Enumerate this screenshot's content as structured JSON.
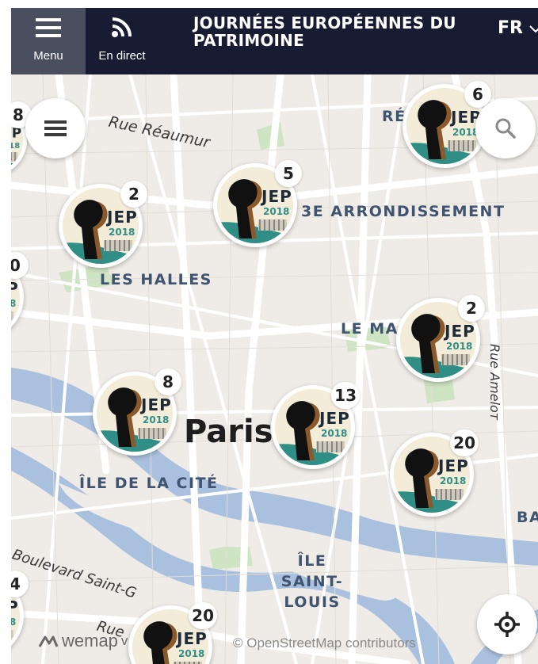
{
  "header": {
    "menu_label": "Menu",
    "live_label": "En direct",
    "title": "JOURNÉES EUROPÉENNES DU PATRIMOINE",
    "language": "FR"
  },
  "map": {
    "streets": [
      "Rue Réaumur",
      "Boulevard Saint-G",
      "Rue Ameloт",
      "Rue"
    ],
    "districts": [
      "RÉ",
      "3E ARRONDISSEMENT",
      "LES HALLES",
      "LE MA",
      "ÎLE DE LA CITÉ",
      "ÎLE SAINT-LOUIS",
      "BA"
    ],
    "city": "Paris",
    "clusters": [
      {
        "count": "6"
      },
      {
        "count": "5"
      },
      {
        "count": "2"
      },
      {
        "count": "2"
      },
      {
        "count": "8"
      },
      {
        "count": "13"
      },
      {
        "count": "20"
      },
      {
        "count": "20"
      },
      {
        "count": "8"
      },
      {
        "count": "0"
      },
      {
        "count": "4"
      }
    ],
    "logo_text": "JEP",
    "logo_year": "2018"
  },
  "footer": {
    "brand": "wemap",
    "brand_suffix": "v",
    "attribution": "© OpenStreetMap contributors"
  },
  "colors": {
    "header_bg": "#171c33",
    "menu_bg": "#4a4f5f",
    "water": "#a9c1de",
    "park": "#cfe4c2",
    "land": "#efebe6",
    "district_text": "#3f5470",
    "logo_teal": "#2f8e86",
    "logo_brown": "#8a5a2c"
  }
}
